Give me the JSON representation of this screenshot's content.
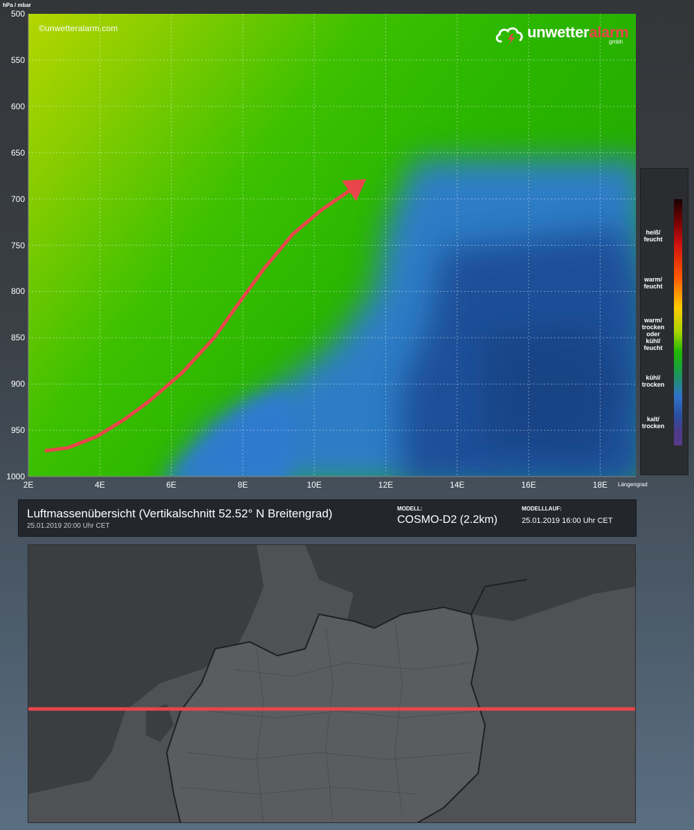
{
  "chart_data": {
    "type": "heatmap",
    "title": "Luftmassenübersicht (Vertikalschnitt 52.52° N Breitengrad)",
    "ylabel": "hPa / mbar",
    "xlabel": "Längengrad",
    "y_ticks": [
      "500",
      "550",
      "600",
      "650",
      "700",
      "750",
      "800",
      "850",
      "900",
      "950",
      "1000"
    ],
    "x_ticks": [
      "2E",
      "4E",
      "6E",
      "8E",
      "10E",
      "12E",
      "14E",
      "16E",
      "18E"
    ],
    "ylim": [
      1000,
      500
    ],
    "xlim": [
      2,
      19
    ],
    "grid": true,
    "legend": {
      "placement": "right",
      "labels": [
        "heiß/ feucht",
        "warm/ feucht",
        "warm/ trocken oder kühl/ feucht",
        "kühl/ trocken",
        "kalt/ trocken"
      ]
    },
    "annotation": {
      "type": "arrow",
      "color": "#e8464a",
      "points": [
        [
          2.5,
          972
        ],
        [
          3.1,
          969
        ],
        [
          3.9,
          957
        ],
        [
          4.7,
          938
        ],
        [
          5.4,
          918
        ],
        [
          6.3,
          888
        ],
        [
          7.2,
          850
        ],
        [
          7.9,
          812
        ],
        [
          8.6,
          775
        ],
        [
          9.4,
          738
        ],
        [
          10.2,
          712
        ],
        [
          11.1,
          688
        ]
      ]
    },
    "colors": {
      "yellow_green": "#b5d600",
      "green": "#2fbd00",
      "blue": "#2f7ad0",
      "dark_blue": "#1f4d96"
    }
  },
  "watermark": {
    "copyright": "©unwetteralarm.com",
    "brand_main": "unwetter",
    "brand_accent": "alarm",
    "brand_sub": "gmbh"
  },
  "info": {
    "title": "Luftmassenübersicht (Vertikalschnitt 52.52° N Breitengrad)",
    "valid": "25.01.2019 20:00 Uhr CET",
    "model_header": "MODELL:",
    "model": "COSMO-D2 (2.2km)",
    "run_header": "MODELLLAUF:",
    "run": "25.01.2019 16:00 Uhr CET"
  },
  "map": {
    "transect_color": "#e8464a",
    "latitude": "52.52° N"
  }
}
